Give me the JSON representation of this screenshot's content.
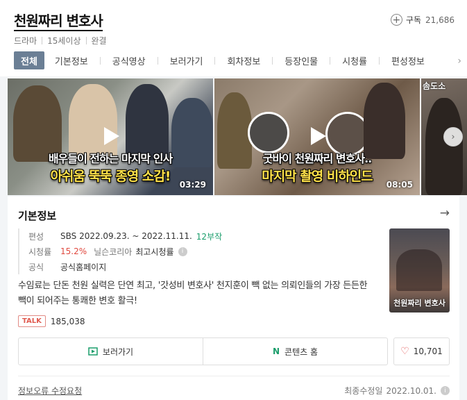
{
  "header": {
    "title": "천원짜리 변호사",
    "subscribe_label": "구독",
    "subscribe_count": "21,686",
    "meta": [
      "드라마",
      "15세이상",
      "완결"
    ]
  },
  "tabs": [
    {
      "label": "전체",
      "active": true
    },
    {
      "label": "기본정보"
    },
    {
      "label": "공식영상"
    },
    {
      "label": "보러가기"
    },
    {
      "label": "회차정보"
    },
    {
      "label": "등장인물"
    },
    {
      "label": "시청률"
    },
    {
      "label": "편성정보"
    }
  ],
  "videos": [
    {
      "caption_line1": "배우들이 전하는 마지막 인사",
      "caption_line2": "아쉬움 뚝뚝 종영 소감!",
      "duration": "03:29"
    },
    {
      "caption_line1": "굿바이 천원짜리 변호사..",
      "caption_line2": "마지막 촬영 비하인드",
      "duration": "08:05"
    },
    {
      "caption_line1": "솜도소"
    }
  ],
  "info": {
    "heading": "기본정보",
    "rows": [
      {
        "label": "편성",
        "value": "SBS  2022.09.23. ~ 2022.11.11.",
        "extra": "12부작"
      },
      {
        "label": "시청률",
        "value": "15.2%",
        "source": "닐슨코리아",
        "extra": "최고시청률"
      },
      {
        "label": "공식",
        "value": "공식홈페이지"
      }
    ],
    "synopsis": "수임료는 단돈 천원 실력은 단연 최고, '갓성비 변호사' 천지훈이 빽 없는 의뢰인들의 가장 든든한 빽이 되어주는 통쾌한 변호 활극!",
    "poster_title": "천원짜리 변호사",
    "talk_label": "TALK",
    "talk_count": "185,038",
    "watch_label": "보러가기",
    "content_home_label": "콘텐츠 홈",
    "content_home_icon": "N",
    "like_count": "10,701",
    "report_label": "정보오류 수정요청",
    "updated_label": "최종수정일",
    "updated_date": "2022.10.01."
  },
  "colors": {
    "active_tab_bg": "#6b7f95",
    "accent_green": "#1a9d6b",
    "rating_red": "#e0483e",
    "talk_red": "#e05a4f"
  }
}
